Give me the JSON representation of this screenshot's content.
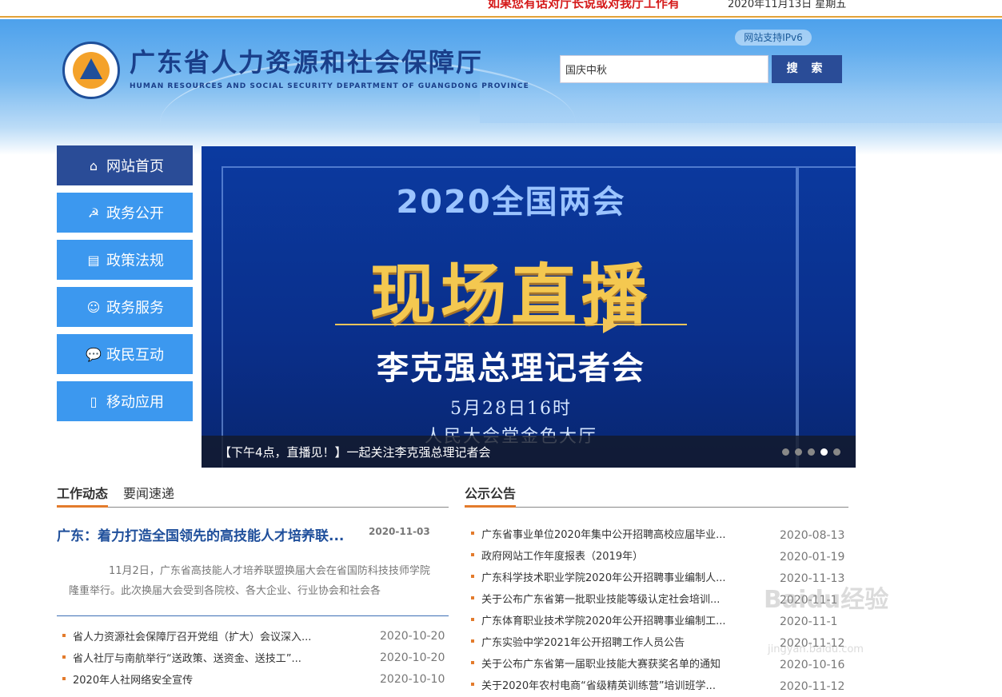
{
  "topbar": {
    "notice": "如果您有话对厅长说或对我厅工作有",
    "date": "2020年11月13日 星期五"
  },
  "header": {
    "title": "广东省人力资源和社会保障厅",
    "subtitle": "HUMAN RESOURCES AND SOCIAL SECURITY DEPARTMENT OF GUANGDONG PROVINCE",
    "ipv6": "网站支持IPv6",
    "search_value": "国庆中秋",
    "search_button": "搜 索"
  },
  "nav": [
    {
      "label": "网站首页",
      "icon": "home-icon",
      "glyph": "⌂",
      "active": true
    },
    {
      "label": "政务公开",
      "icon": "emblem-icon",
      "glyph": "☭",
      "active": false
    },
    {
      "label": "政策法规",
      "icon": "book-icon",
      "glyph": "▤",
      "active": false
    },
    {
      "label": "政务服务",
      "icon": "person-icon",
      "glyph": "☺",
      "active": false
    },
    {
      "label": "政民互动",
      "icon": "chat-icon",
      "glyph": "💬",
      "active": false
    },
    {
      "label": "移动应用",
      "icon": "phone-icon",
      "glyph": "▯",
      "active": false
    }
  ],
  "slider": {
    "year_title": "2020全国两会",
    "main": "现场直播",
    "sub": "李克强总理记者会",
    "time": "5月28日16时",
    "place": "人民大会堂金色大厅",
    "caption": "【下午4点，直播见！】一起关注李克强总理记者会",
    "dots": 5,
    "active_dot": 4
  },
  "work": {
    "tabs": [
      "工作动态",
      "要闻速递"
    ],
    "headline": "广东：着力打造全国领先的高技能人才培养联...",
    "headline_date": "2020-11-03",
    "summary": "11月2日，广东省高技能人才培养联盟换届大会在省国防科技技师学院隆重举行。此次换届大会受到各院校、各大企业、行业协会和社会各",
    "items": [
      {
        "title": "省人力资源社会保障厅召开党组（扩大）会议深入...",
        "date": "2020-10-20"
      },
      {
        "title": "省人社厅与南航举行“送政策、送资金、送技工”...",
        "date": "2020-10-20"
      },
      {
        "title": "2020年人社网络安全宣传",
        "date": "2020-10-10"
      }
    ]
  },
  "notice": {
    "tab": "公示公告",
    "items": [
      {
        "title": "广东省事业单位2020年集中公开招聘高校应届毕业...",
        "date": "2020-08-13"
      },
      {
        "title": "政府网站工作年度报表（2019年）",
        "date": "2020-01-19"
      },
      {
        "title": "广东科学技术职业学院2020年公开招聘事业编制人...",
        "date": "2020-11-13"
      },
      {
        "title": "关于公布广东省第一批职业技能等级认定社会培训...",
        "date": "2020-11-1"
      },
      {
        "title": "广东体育职业技术学院2020年公开招聘事业编制工...",
        "date": "2020-11-1"
      },
      {
        "title": "广东实验中学2021年公开招聘工作人员公告",
        "date": "2020-11-12"
      },
      {
        "title": "关于公布广东省第一届职业技能大赛获奖名单的通知",
        "date": "2020-10-16"
      },
      {
        "title": "关于2020年农村电商“省级精英训练营”培训班学...",
        "date": "2020-11-12"
      }
    ]
  },
  "watermark": {
    "text": "Baidu经验",
    "url": "jingyan.baidu.com"
  },
  "colors": {
    "nav_active": "#2a4c97",
    "nav": "#3c98ef",
    "accent": "#e37b2c",
    "link": "#1f4f9b"
  }
}
